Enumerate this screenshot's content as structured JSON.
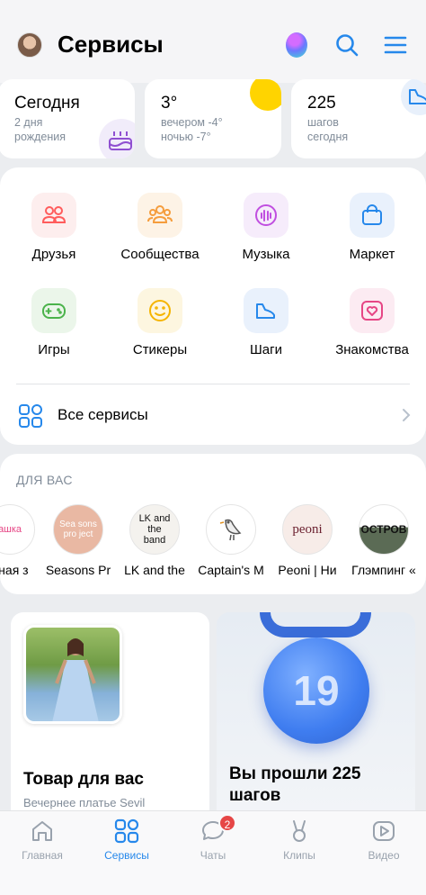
{
  "header": {
    "title": "Сервисы",
    "icons": [
      "avatar",
      "alice-icon",
      "search-icon",
      "menu-icon"
    ]
  },
  "widgets": [
    {
      "title": "Сегодня",
      "line1": "2 дня",
      "line2": "рождения",
      "icon": "cake-icon"
    },
    {
      "title": "3°",
      "line1": "вечером -4°",
      "line2": "ночью -7°",
      "icon": "sun-icon"
    },
    {
      "title": "225",
      "line1": "шагов",
      "line2": "сегодня",
      "icon": "shoe-icon"
    }
  ],
  "services": [
    {
      "label": "Друзья",
      "icon": "friends-icon",
      "color": "#ff5c5c",
      "bg": "#fdeeee"
    },
    {
      "label": "Сообщества",
      "icon": "communities-icon",
      "color": "#f59d3d",
      "bg": "#fdf3e6"
    },
    {
      "label": "Музыка",
      "icon": "music-icon",
      "color": "#c04fe0",
      "bg": "#f6ecfb"
    },
    {
      "label": "Маркет",
      "icon": "market-icon",
      "color": "#2688eb",
      "bg": "#e9f1fc"
    },
    {
      "label": "Игры",
      "icon": "games-icon",
      "color": "#4bb34b",
      "bg": "#ebf6ea"
    },
    {
      "label": "Стикеры",
      "icon": "stickers-icon",
      "color": "#f5b400",
      "bg": "#fdf6e0"
    },
    {
      "label": "Шаги",
      "icon": "steps-icon",
      "color": "#2688eb",
      "bg": "#e9f1fc"
    },
    {
      "label": "Знакомства",
      "icon": "dating-icon",
      "color": "#e64685",
      "bg": "#fcebf2"
    }
  ],
  "all_services": {
    "label": "Все сервисы"
  },
  "for_you": {
    "title": "ДЛЯ ВАС",
    "items": [
      {
        "label": "рная з",
        "logo": "ашка"
      },
      {
        "label": "Seasons Pr",
        "logo": "Sea sons pro ject"
      },
      {
        "label": "LK and the",
        "logo": "LK and the band"
      },
      {
        "label": "Captain's M",
        "logo": ""
      },
      {
        "label": "Peoni | Ни",
        "logo": "peoni"
      },
      {
        "label": "Глэмпинг «",
        "logo": "ОСТРОВ"
      }
    ]
  },
  "promos": [
    {
      "title": "Товар для вас",
      "subtitle": "Вечернее платье Sevil"
    },
    {
      "title": "Вы прошли 225 шагов",
      "medal_value": "19"
    }
  ],
  "tabbar": {
    "tabs": [
      {
        "label": "Главная",
        "icon": "home-icon",
        "active": false
      },
      {
        "label": "Сервисы",
        "icon": "services-icon",
        "active": true
      },
      {
        "label": "Чаты",
        "icon": "chats-icon",
        "active": false,
        "badge": "2"
      },
      {
        "label": "Клипы",
        "icon": "clips-icon",
        "active": false
      },
      {
        "label": "Видео",
        "icon": "video-icon",
        "active": false
      }
    ]
  },
  "colors": {
    "accent": "#2688eb",
    "secondary_text": "#818c99",
    "badge": "#e64646"
  }
}
